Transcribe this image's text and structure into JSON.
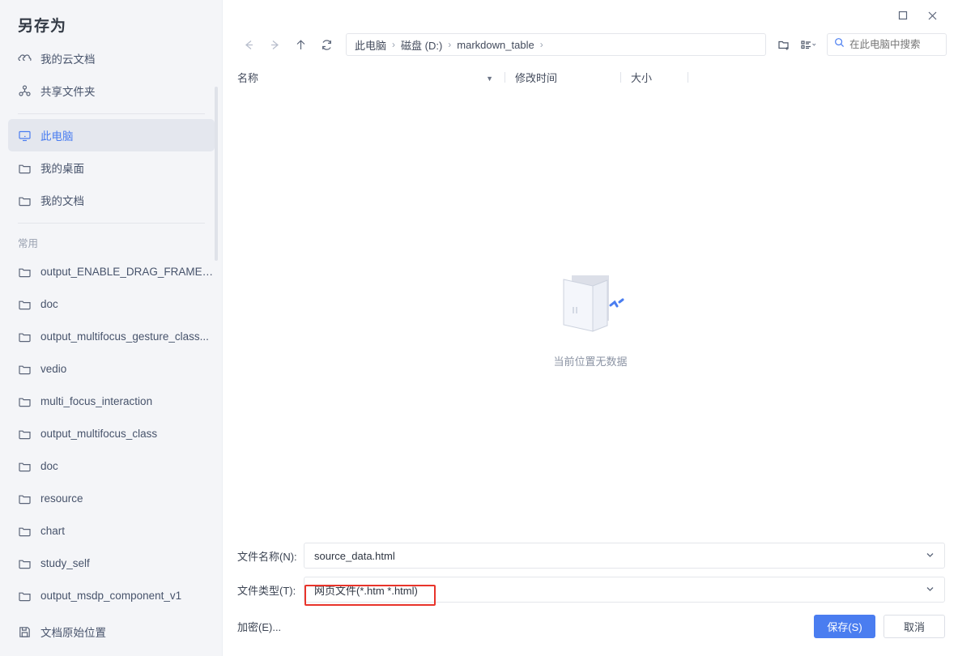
{
  "dialog": {
    "title": "另存为"
  },
  "window_controls": {
    "maximize": "□",
    "close": "✕"
  },
  "sidebar": {
    "top_items": [
      {
        "label": "我的云文档",
        "icon": "cloud-icon"
      },
      {
        "label": "共享文件夹",
        "icon": "share-icon"
      }
    ],
    "locations": [
      {
        "label": "此电脑",
        "icon": "computer-icon",
        "selected": true
      },
      {
        "label": "我的桌面",
        "icon": "folder-icon",
        "selected": false
      },
      {
        "label": "我的文档",
        "icon": "folder-icon",
        "selected": false
      }
    ],
    "section_label": "常用",
    "frequent": [
      {
        "label": "output_ENABLE_DRAG_FRAMEW...",
        "icon": "folder-icon"
      },
      {
        "label": "doc",
        "icon": "folder-icon"
      },
      {
        "label": "output_multifocus_gesture_class...",
        "icon": "folder-icon"
      },
      {
        "label": "vedio",
        "icon": "folder-icon"
      },
      {
        "label": "multi_focus_interaction",
        "icon": "folder-icon"
      },
      {
        "label": "output_multifocus_class",
        "icon": "folder-icon"
      },
      {
        "label": "doc",
        "icon": "folder-icon"
      },
      {
        "label": "resource",
        "icon": "folder-icon"
      },
      {
        "label": "chart",
        "icon": "folder-icon"
      },
      {
        "label": "study_self",
        "icon": "folder-icon"
      },
      {
        "label": "output_msdp_component_v1",
        "icon": "folder-icon"
      }
    ],
    "footer": {
      "label": "文档原始位置",
      "icon": "save-icon"
    }
  },
  "toolbar": {
    "back": "back-arrow-icon",
    "forward": "forward-arrow-icon",
    "up": "up-arrow-icon",
    "refresh": "refresh-icon",
    "breadcrumb": [
      "此电脑",
      "磁盘 (D:)",
      "markdown_table"
    ],
    "breadcrumb_separator": "›",
    "new_folder": "new-folder-icon",
    "view_options": "view-list-icon",
    "search_placeholder": "在此电脑中搜索",
    "search_value": ""
  },
  "columns": [
    {
      "key": "name",
      "label": "名称"
    },
    {
      "key": "modified",
      "label": "修改时间"
    },
    {
      "key": "size",
      "label": "大小"
    }
  ],
  "file_list": {
    "rows": [],
    "empty_message": "当前位置无数据"
  },
  "form": {
    "filename": {
      "label": "文件名称(N):",
      "value": "source_data.html"
    },
    "filetype": {
      "label": "文件类型(T):",
      "value": "网页文件(*.htm *.html)"
    },
    "encrypt_label": "加密(E)...",
    "save_label": "保存(S)",
    "cancel_label": "取消"
  },
  "colors": {
    "accent": "#4a7df0",
    "sidebar_bg": "#f4f5f8",
    "selected_bg": "#e4e7ee",
    "highlight_box": "#e8342a",
    "text": "#3c4453"
  }
}
